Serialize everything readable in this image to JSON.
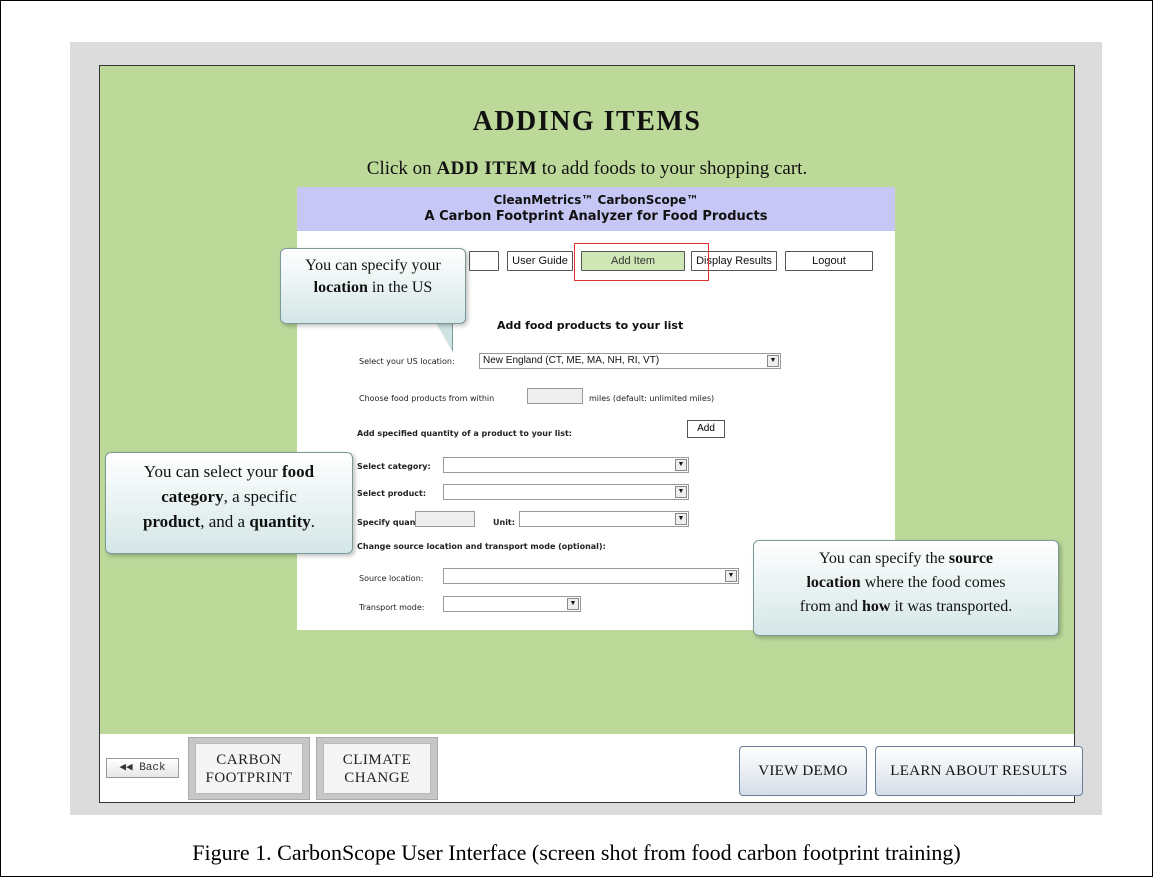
{
  "slide": {
    "title": "ADDING ITEMS",
    "subtitle_pre": "Click on ",
    "subtitle_bold": "ADD ITEM",
    "subtitle_post": " to add foods to your shopping cart."
  },
  "app": {
    "header_line1": "CleanMetrics™ CarbonScope™",
    "header_line2": "A Carbon Footprint Analyzer for Food Products",
    "nav": {
      "user_guide": "User Guide",
      "add_item": "Add Item",
      "display_results": "Display Results",
      "logout": "Logout"
    },
    "form": {
      "heading": "Add food products to your list",
      "location_label": "Select your US location:",
      "location_value": "New England (CT, ME, MA, NH, RI, VT)",
      "choose_label": "Choose food products from within",
      "choose_suffix": "miles (default: unlimited miles)",
      "add_quantity_label": "Add specified quantity of a product to your list:",
      "add_button": "Add",
      "category_label": "Select category:",
      "product_label": "Select product:",
      "quantity_label": "Specify quantity:",
      "unit_label": "Unit:",
      "change_source_label": "Change source location and transport mode (optional):",
      "source_location_label": "Source location:",
      "transport_mode_label": "Transport mode:"
    }
  },
  "callouts": {
    "location": {
      "line1": "You can specify your",
      "line2_bold": "location",
      "line2_rest": " in the US"
    },
    "food": {
      "l1_pre": "You can select your ",
      "l1_bold": "food",
      "l2_bold": "category",
      "l2_rest": ", a specific",
      "l3_bold": "product",
      "l3_mid": ", and a ",
      "l3_bold2": "quantity",
      "l3_end": "."
    },
    "source": {
      "l1_pre": "You can specify the ",
      "l1_bold": "source",
      "l2_bold": "location",
      "l2_rest": " where the food comes",
      "l3_pre": "from and ",
      "l3_bold": "how",
      "l3_rest": " it was transported."
    }
  },
  "bottom": {
    "back": "◀◀ Back",
    "carbon_l1": "CARBON",
    "carbon_l2": "FOOTPRINT",
    "climate_l1": "CLIMATE",
    "climate_l2": "CHANGE",
    "view_demo": "VIEW DEMO",
    "learn": "LEARN ABOUT RESULTS"
  },
  "caption": "Figure 1. CarbonScope User Interface (screen shot from food carbon footprint training)",
  "colors": {
    "green_bg": "#bcd99a",
    "header_purple": "#c7c7f5",
    "highlight_red": "#e03030"
  }
}
